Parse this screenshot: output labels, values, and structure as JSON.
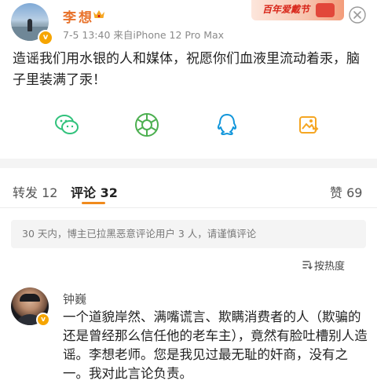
{
  "post": {
    "author": "李想",
    "verified_mark": "v",
    "meta": "7-5 13:40  来自iPhone 12 Pro Max",
    "banner_text": "百年爱戴节",
    "text": "造谣我们用水银的人和媒体，祝愿你们血液里流动着汞，脑子里装满了汞！",
    "share_icons": [
      "wechat-icon",
      "moments-icon",
      "qq-icon",
      "qzone-icon"
    ]
  },
  "tabs": {
    "repost": "转发 12",
    "comment": "评论 32",
    "like": "赞 69"
  },
  "notice": "30 天内，博主已拉黑恶意评论用户 3 人，请谨慎评论",
  "sort_label": "按热度",
  "comment": {
    "name": "钟巍",
    "verified_mark": "v",
    "text": "一个道貌岸然、满嘴谎言、欺瞒消费者的人（欺骗的还是曾经那么信任他的老车主），竟然有脸吐槽别人造谣。李想老师。您是我见过最无耻的奸商，没有之一。我对此言论负责。"
  },
  "colors": {
    "accent": "#f08a1c",
    "username": "#e8722b",
    "wechat": "#31c27c",
    "moments": "#4caf50",
    "qq": "#1296db",
    "qzone": "#f5a623"
  }
}
